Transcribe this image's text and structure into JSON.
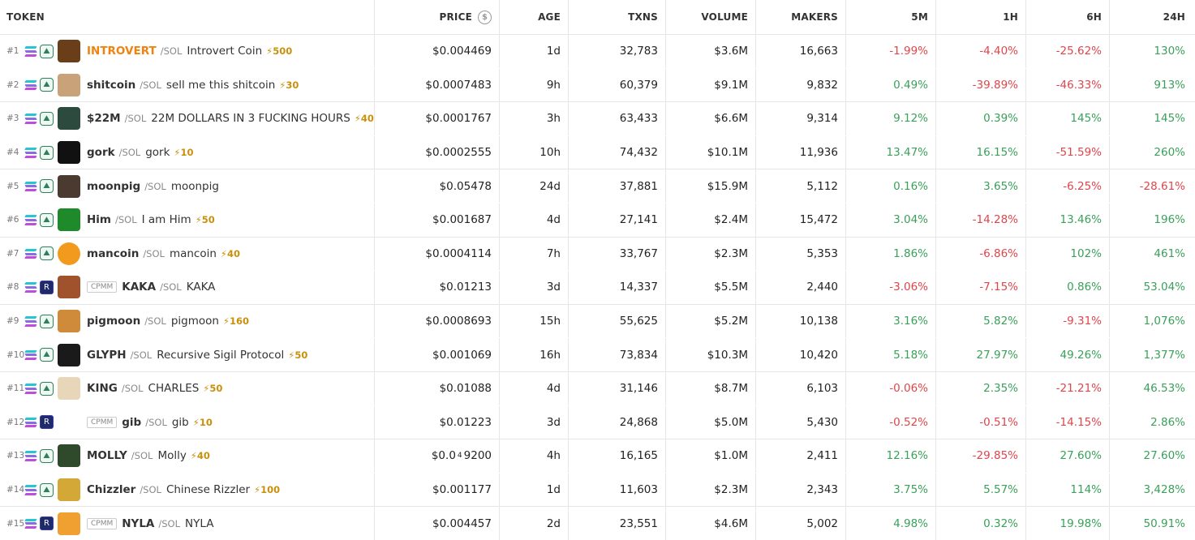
{
  "headers": {
    "token": "TOKEN",
    "price": "PRICE",
    "age": "AGE",
    "txns": "TXNS",
    "volume": "VOLUME",
    "makers": "MAKERS",
    "m5": "5M",
    "h1": "1H",
    "h6": "6H",
    "h24": "24H",
    "price_icon": "$"
  },
  "colors": {
    "positive": "#3aa05a",
    "negative": "#e0454a",
    "hot_symbol": "#f0820f",
    "boost": "#c9900b"
  },
  "rows": [
    {
      "rank": "#1",
      "dex": "pumpswap-icon",
      "cpmm": "",
      "avatar_color": "#6b3e1a",
      "avatar_icon": "introvert-avatar",
      "symbol": "INTROVERT",
      "hot": true,
      "quote": "/SOL",
      "name": "Introvert Coin",
      "boost": "⚡500",
      "price": "$0.004469",
      "price_sub": "",
      "price_tail": "",
      "age": "1d",
      "txns": "32,783",
      "volume": "$3.6M",
      "makers": "16,663",
      "m5": "-1.99%",
      "h1": "-4.40%",
      "h6": "-25.62%",
      "h24": "130%",
      "m5s": "neg",
      "h1s": "neg",
      "h6s": "neg",
      "h24s": "pos"
    },
    {
      "rank": "#2",
      "dex": "pumpswap-icon",
      "cpmm": "",
      "avatar_color": "#c9a27a",
      "avatar_icon": "shitcoin-avatar",
      "symbol": "shitcoin",
      "hot": false,
      "quote": "/SOL",
      "name": "sell me this shitcoin",
      "boost": "⚡30",
      "price": "$0.0007483",
      "price_sub": "",
      "price_tail": "",
      "age": "9h",
      "txns": "60,379",
      "volume": "$9.1M",
      "makers": "9,832",
      "m5": "0.49%",
      "h1": "-39.89%",
      "h6": "-46.33%",
      "h24": "913%",
      "m5s": "pos",
      "h1s": "neg",
      "h6s": "neg",
      "h24s": "pos"
    },
    {
      "rank": "#3",
      "dex": "pumpswap-icon",
      "cpmm": "",
      "avatar_color": "#2d4a3e",
      "avatar_icon": "22m-avatar",
      "symbol": "$22M",
      "hot": false,
      "quote": "/SOL",
      "name": "22M DOLLARS IN 3 FUCKING HOURS",
      "boost": "⚡40",
      "price": "$0.0001767",
      "price_sub": "",
      "price_tail": "",
      "age": "3h",
      "txns": "63,433",
      "volume": "$6.6M",
      "makers": "9,314",
      "m5": "9.12%",
      "h1": "0.39%",
      "h6": "145%",
      "h24": "145%",
      "m5s": "pos",
      "h1s": "pos",
      "h6s": "pos",
      "h24s": "pos"
    },
    {
      "rank": "#4",
      "dex": "pumpswap-icon",
      "cpmm": "",
      "avatar_color": "#111111",
      "avatar_icon": "gork-avatar",
      "symbol": "gork",
      "hot": false,
      "quote": "/SOL",
      "name": "gork",
      "boost": "⚡10",
      "price": "$0.0002555",
      "price_sub": "",
      "price_tail": "",
      "age": "10h",
      "txns": "74,432",
      "volume": "$10.1M",
      "makers": "11,936",
      "m5": "13.47%",
      "h1": "16.15%",
      "h6": "-51.59%",
      "h24": "260%",
      "m5s": "pos",
      "h1s": "pos",
      "h6s": "neg",
      "h24s": "pos"
    },
    {
      "rank": "#5",
      "dex": "pumpswap-icon",
      "cpmm": "",
      "avatar_color": "#4a3a30",
      "avatar_icon": "moonpig-avatar",
      "symbol": "moonpig",
      "hot": false,
      "quote": "/SOL",
      "name": "moonpig",
      "boost": "",
      "price": "$0.05478",
      "price_sub": "",
      "price_tail": "",
      "age": "24d",
      "txns": "37,881",
      "volume": "$15.9M",
      "makers": "5,112",
      "m5": "0.16%",
      "h1": "3.65%",
      "h6": "-6.25%",
      "h24": "-28.61%",
      "m5s": "pos",
      "h1s": "pos",
      "h6s": "neg",
      "h24s": "neg"
    },
    {
      "rank": "#6",
      "dex": "pumpswap-icon",
      "cpmm": "",
      "avatar_color": "#1f8a2a",
      "avatar_icon": "him-avatar",
      "symbol": "Him",
      "hot": false,
      "quote": "/SOL",
      "name": "I am Him",
      "boost": "⚡50",
      "price": "$0.001687",
      "price_sub": "",
      "price_tail": "",
      "age": "4d",
      "txns": "27,141",
      "volume": "$2.4M",
      "makers": "15,472",
      "m5": "3.04%",
      "h1": "-14.28%",
      "h6": "13.46%",
      "h24": "196%",
      "m5s": "pos",
      "h1s": "neg",
      "h6s": "pos",
      "h24s": "pos"
    },
    {
      "rank": "#7",
      "dex": "pumpswap-icon",
      "cpmm": "",
      "avatar_color": "#f29a1e",
      "avatar_icon": "mancoin-avatar",
      "symbol": "mancoin",
      "hot": false,
      "quote": "/SOL",
      "name": "mancoin",
      "boost": "⚡40",
      "price": "$0.0004114",
      "price_sub": "",
      "price_tail": "",
      "age": "7h",
      "txns": "33,767",
      "volume": "$2.3M",
      "makers": "5,353",
      "m5": "1.86%",
      "h1": "-6.86%",
      "h6": "102%",
      "h24": "461%",
      "m5s": "pos",
      "h1s": "neg",
      "h6s": "pos",
      "h24s": "pos"
    },
    {
      "rank": "#8",
      "dex": "raydium-icon",
      "cpmm": "CPMM",
      "avatar_color": "#a0522d",
      "avatar_icon": "kaka-avatar",
      "symbol": "KAKA",
      "hot": false,
      "quote": "/SOL",
      "name": "KAKA",
      "boost": "",
      "price": "$0.01213",
      "price_sub": "",
      "price_tail": "",
      "age": "3d",
      "txns": "14,337",
      "volume": "$5.5M",
      "makers": "2,440",
      "m5": "-3.06%",
      "h1": "-7.15%",
      "h6": "0.86%",
      "h24": "53.04%",
      "m5s": "neg",
      "h1s": "neg",
      "h6s": "pos",
      "h24s": "pos"
    },
    {
      "rank": "#9",
      "dex": "pumpswap-icon",
      "cpmm": "",
      "avatar_color": "#d08b3a",
      "avatar_icon": "pigmoon-avatar",
      "symbol": "pigmoon",
      "hot": false,
      "quote": "/SOL",
      "name": "pigmoon",
      "boost": "⚡160",
      "price": "$0.0008693",
      "price_sub": "",
      "price_tail": "",
      "age": "15h",
      "txns": "55,625",
      "volume": "$5.2M",
      "makers": "10,138",
      "m5": "3.16%",
      "h1": "5.82%",
      "h6": "-9.31%",
      "h24": "1,076%",
      "m5s": "pos",
      "h1s": "pos",
      "h6s": "neg",
      "h24s": "pos"
    },
    {
      "rank": "#10",
      "dex": "pumpswap-icon",
      "cpmm": "",
      "avatar_color": "#1a1a1a",
      "avatar_icon": "glyph-avatar",
      "symbol": "GLYPH",
      "hot": false,
      "quote": "/SOL",
      "name": "Recursive Sigil Protocol",
      "boost": "⚡50",
      "price": "$0.001069",
      "price_sub": "",
      "price_tail": "",
      "age": "16h",
      "txns": "73,834",
      "volume": "$10.3M",
      "makers": "10,420",
      "m5": "5.18%",
      "h1": "27.97%",
      "h6": "49.26%",
      "h24": "1,377%",
      "m5s": "pos",
      "h1s": "pos",
      "h6s": "pos",
      "h24s": "pos"
    },
    {
      "rank": "#11",
      "dex": "pumpswap-icon",
      "cpmm": "",
      "avatar_color": "#e8d6b8",
      "avatar_icon": "king-avatar",
      "symbol": "KING",
      "hot": false,
      "quote": "/SOL",
      "name": "CHARLES",
      "boost": "⚡50",
      "price": "$0.01088",
      "price_sub": "",
      "price_tail": "",
      "age": "4d",
      "txns": "31,146",
      "volume": "$8.7M",
      "makers": "6,103",
      "m5": "-0.06%",
      "h1": "2.35%",
      "h6": "-21.21%",
      "h24": "46.53%",
      "m5s": "neg",
      "h1s": "pos",
      "h6s": "neg",
      "h24s": "pos"
    },
    {
      "rank": "#12",
      "dex": "raydium-icon",
      "cpmm": "CPMM",
      "avatar_color": "#ffffff",
      "avatar_icon": "gib-avatar",
      "symbol": "gib",
      "hot": false,
      "quote": "/SOL",
      "name": "gib",
      "boost": "⚡10",
      "price": "$0.01223",
      "price_sub": "",
      "price_tail": "",
      "age": "3d",
      "txns": "24,868",
      "volume": "$5.0M",
      "makers": "5,430",
      "m5": "-0.52%",
      "h1": "-0.51%",
      "h6": "-14.15%",
      "h24": "2.86%",
      "m5s": "neg",
      "h1s": "neg",
      "h6s": "neg",
      "h24s": "pos"
    },
    {
      "rank": "#13",
      "dex": "pumpswap-icon",
      "cpmm": "",
      "avatar_color": "#2e4a2a",
      "avatar_icon": "molly-avatar",
      "symbol": "MOLLY",
      "hot": false,
      "quote": "/SOL",
      "name": "Molly",
      "boost": "⚡40",
      "price": "$0.0",
      "price_sub": "4",
      "price_tail": "9200",
      "age": "4h",
      "txns": "16,165",
      "volume": "$1.0M",
      "makers": "2,411",
      "m5": "12.16%",
      "h1": "-29.85%",
      "h6": "27.60%",
      "h24": "27.60%",
      "m5s": "pos",
      "h1s": "neg",
      "h6s": "pos",
      "h24s": "pos"
    },
    {
      "rank": "#14",
      "dex": "pumpswap-icon",
      "cpmm": "",
      "avatar_color": "#d4a836",
      "avatar_icon": "chizzler-avatar",
      "symbol": "Chizzler",
      "hot": false,
      "quote": "/SOL",
      "name": "Chinese Rizzler",
      "boost": "⚡100",
      "price": "$0.001177",
      "price_sub": "",
      "price_tail": "",
      "age": "1d",
      "txns": "11,603",
      "volume": "$2.3M",
      "makers": "2,343",
      "m5": "3.75%",
      "h1": "5.57%",
      "h6": "114%",
      "h24": "3,428%",
      "m5s": "pos",
      "h1s": "pos",
      "h6s": "pos",
      "h24s": "pos"
    },
    {
      "rank": "#15",
      "dex": "raydium-icon",
      "cpmm": "CPMM",
      "avatar_color": "#f0a030",
      "avatar_icon": "nyla-avatar",
      "symbol": "NYLA",
      "hot": false,
      "quote": "/SOL",
      "name": "NYLA",
      "boost": "",
      "price": "$0.004457",
      "price_sub": "",
      "price_tail": "",
      "age": "2d",
      "txns": "23,551",
      "volume": "$4.6M",
      "makers": "5,002",
      "m5": "4.98%",
      "h1": "0.32%",
      "h6": "19.98%",
      "h24": "50.91%",
      "m5s": "pos",
      "h1s": "pos",
      "h6s": "pos",
      "h24s": "pos"
    }
  ]
}
